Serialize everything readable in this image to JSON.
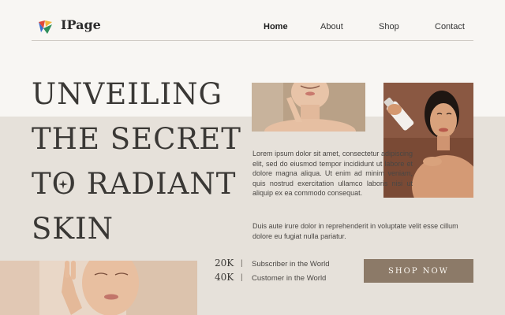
{
  "header": {
    "brand": "IPage",
    "logo_icon": "colorful-leaf-logo",
    "nav": [
      {
        "label": "Home",
        "active": true
      },
      {
        "label": "About",
        "active": false
      },
      {
        "label": "Shop",
        "active": false
      },
      {
        "label": "Contact",
        "active": false
      }
    ]
  },
  "hero": {
    "headline_lines": [
      "UNVEILING",
      "THE SECRET",
      "TO RADIANT",
      "SKIN"
    ],
    "paragraph_1": "Lorem ipsum dolor sit amet, consectetur adipiscing elit, sed do eiusmod tempor incididunt ut labore et dolore magna aliqua. Ut enim ad minim veniam, quis nostrud exercitation ullamco laboris nisi ut aliquip ex ea commodo consequat.",
    "paragraph_2": "Duis aute irure dolor in reprehenderit in voluptate velit esse cillum dolore eu fugiat nulla pariatur.",
    "images": [
      {
        "name": "woman-touching-neck-photo"
      },
      {
        "name": "woman-holding-serum-bottle-photo"
      },
      {
        "name": "woman-touching-cheek-photo"
      }
    ]
  },
  "stats": [
    {
      "value": "20K",
      "separator": "|",
      "label": "Subscriber in the World"
    },
    {
      "value": "40K",
      "separator": "|",
      "label": "Customer in the World"
    }
  ],
  "cta": {
    "label": "SHOP NOW"
  },
  "colors": {
    "background": "#f8f6f3",
    "band": "#e6e1da",
    "button": "#8c7a68",
    "text_dark": "#3a3835"
  }
}
